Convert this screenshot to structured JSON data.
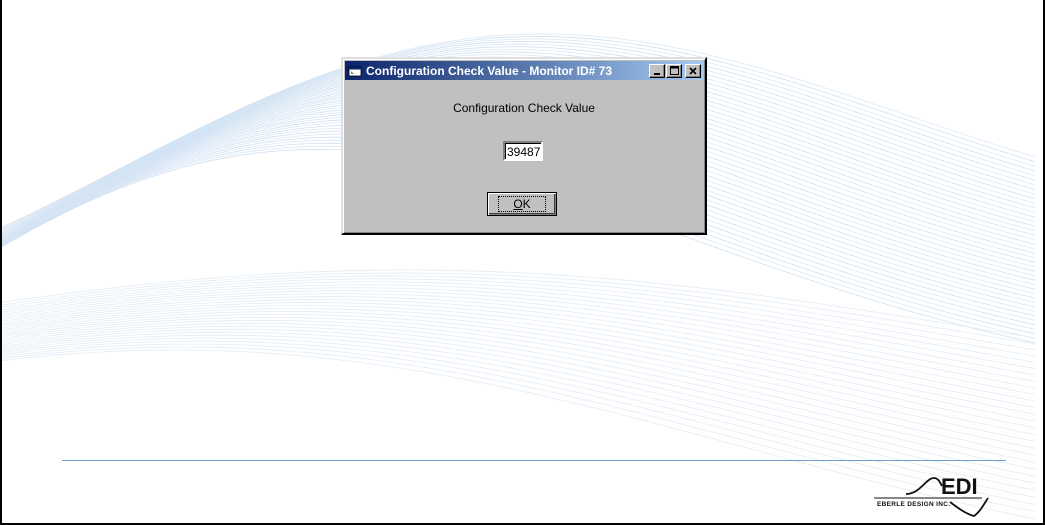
{
  "dialog": {
    "title": "Configuration Check Value - Monitor ID# 73",
    "label": "Configuration Check Value",
    "value": "39487",
    "ok_mnemonic": "O",
    "ok_rest": "K"
  },
  "logo": {
    "word": "EDI",
    "tagline": "EBERLE DESIGN INC."
  },
  "colors": {
    "titlebar_start": "#0a246a",
    "titlebar_end": "#a6caf0",
    "dialog_face": "#c0c0c0",
    "footer_line": "#6f9fd0"
  },
  "icons": {
    "app": "window-app-icon",
    "minimize": "minimize-icon",
    "maximize": "maximize-icon",
    "close": "close-icon"
  }
}
